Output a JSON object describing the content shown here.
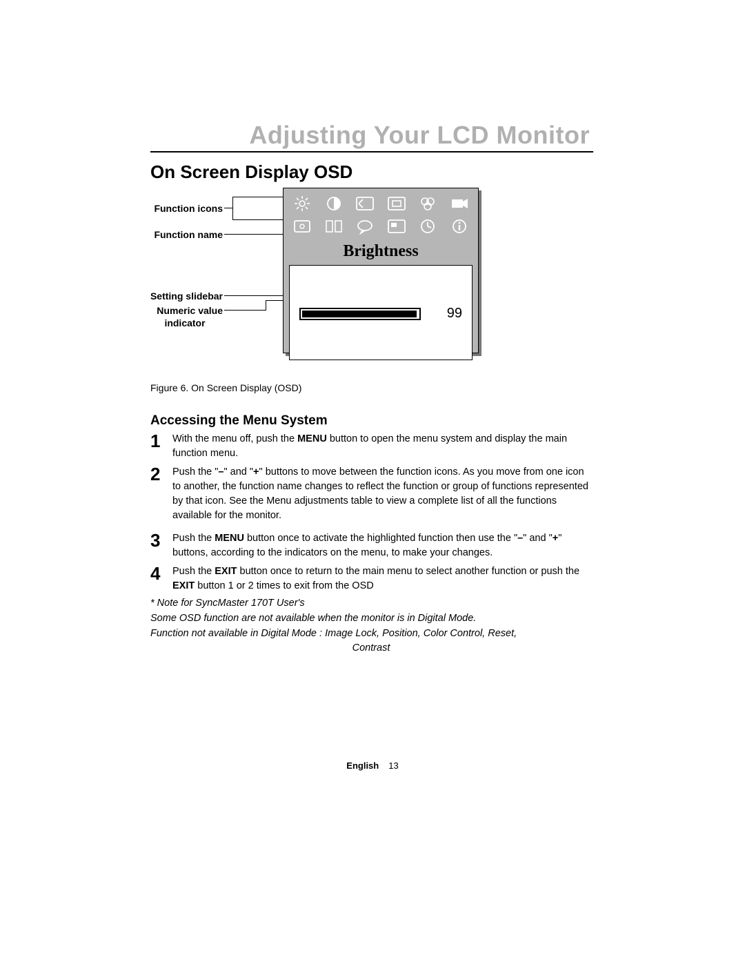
{
  "chapter_title": "Adjusting Your LCD Monitor",
  "section_title": "On Screen Display OSD",
  "callouts": {
    "function_icons": "Function icons",
    "function_name": "Function name",
    "setting_slidebar": "Setting slidebar",
    "numeric_value_indicator_l1": "Numeric value",
    "numeric_value_indicator_l2": "indicator"
  },
  "osd": {
    "function_name": "Brightness",
    "value": "99",
    "icons_row1": [
      "brightness-icon",
      "contrast-icon",
      "image-lock-icon",
      "position-icon",
      "color-control-icon",
      "source-icon"
    ],
    "icons_row2": [
      "zoom-icon",
      "horizontal-icon",
      "language-icon",
      "menu-position-icon",
      "clock-icon",
      "info-icon"
    ]
  },
  "figure_caption": "Figure 6.  On Screen Display (OSD)",
  "subsection_title": "Accessing the Menu System",
  "steps": [
    {
      "num": "1",
      "html": "With the menu off, push the <b>MENU</b> button to open the menu system and display the main function menu."
    },
    {
      "num": "2",
      "html": "Push the \"<b>–</b>\" and \"<b>+</b>\" buttons to move between the function icons. As you move from one icon to another, the function name changes to reflect the function or group of functions represented by that icon. See the Menu adjustments table to view a complete list of all the functions available for the monitor."
    },
    {
      "num": "3",
      "html": "Push the <b>MENU</b> button once to activate the highlighted function then use the \"<b>–</b>\" and \"<b>+</b>\" buttons, according to the indicators on the menu, to make your changes."
    },
    {
      "num": "4",
      "html": "Push the <b>EXIT</b> button once to return to the main menu to select another function or push the <b>EXIT</b> button 1 or 2 times to exit from the OSD"
    }
  ],
  "notes": {
    "line1": "* Note for SyncMaster 170T User's",
    "line2": "Some OSD function are not available when the monitor is in Digital Mode.",
    "line3": "Function not available in Digital Mode : Image Lock, Position, Color Control, Reset,",
    "line4": "Contrast"
  },
  "footer": {
    "lang": "English",
    "page": "13"
  }
}
